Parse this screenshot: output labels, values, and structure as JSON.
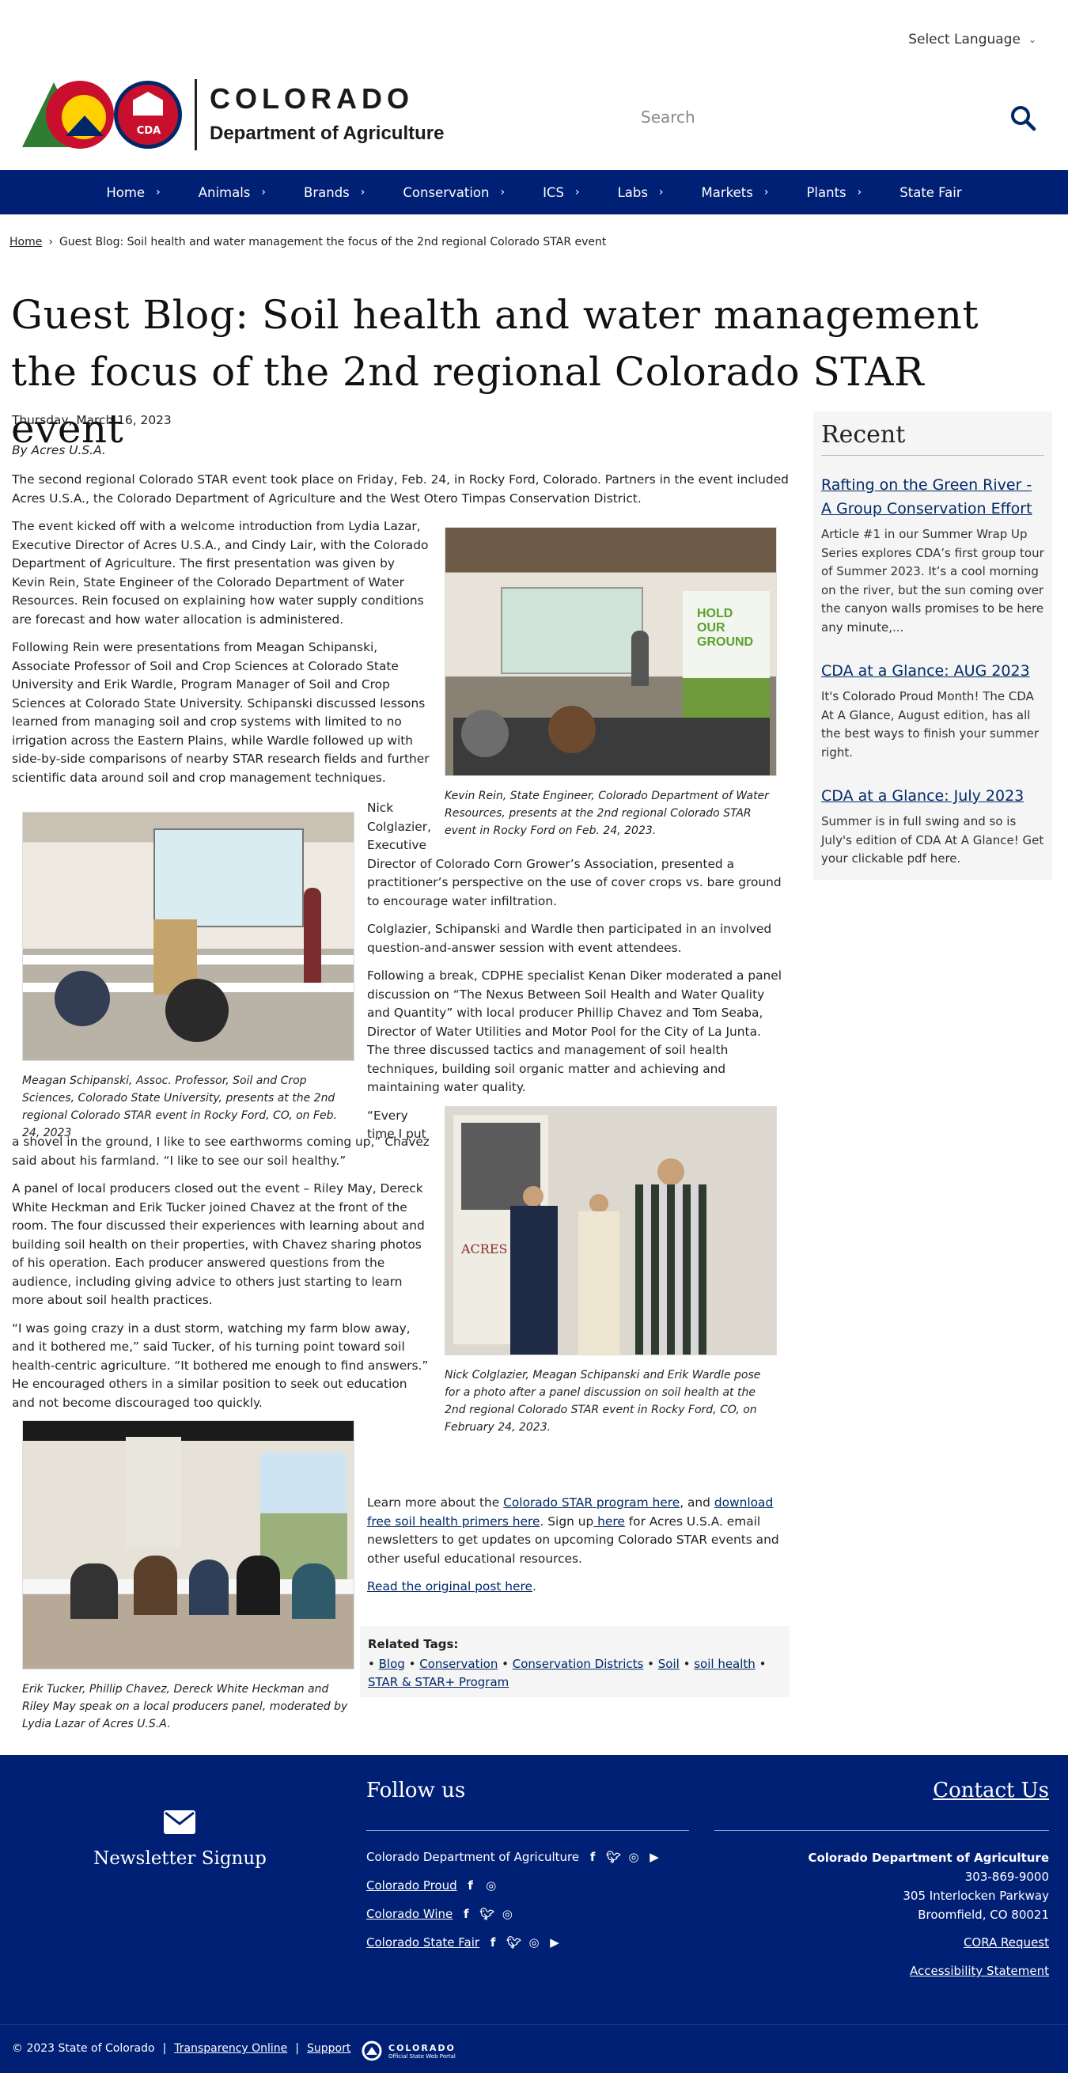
{
  "header": {
    "language_label": "Select Language",
    "logo_title": "COLORADO",
    "logo_subtitle": "Department of Agriculture",
    "logo_badge": "CDA",
    "search_placeholder": "Search"
  },
  "nav": {
    "items": [
      {
        "label": "Home"
      },
      {
        "label": "Animals"
      },
      {
        "label": "Brands"
      },
      {
        "label": "Conservation"
      },
      {
        "label": "ICS"
      },
      {
        "label": "Labs"
      },
      {
        "label": "Markets"
      },
      {
        "label": "Plants"
      },
      {
        "label": "State Fair"
      }
    ]
  },
  "breadcrumb": {
    "home": "Home",
    "current": "Guest Blog: Soil health and water management the focus of the 2nd regional Colorado STAR event"
  },
  "article": {
    "title": "Guest Blog: Soil health and water management the focus of the 2nd regional Colorado STAR event",
    "date": "Thursday, March 16, 2023",
    "byline": "By Acres U.S.A.",
    "p1": "The second regional Colorado STAR event took place on Friday, Feb. 24, in Rocky Ford, Colorado. Partners in the event included Acres U.S.A., the Colorado Department of Agriculture and the West Otero Timpas Conservation District.",
    "p2": "The event kicked off with a welcome introduction from Lydia Lazar, Executive Director of Acres U.S.A., and Cindy Lair, with the Colorado Department of Agriculture. The first presentation was given by Kevin Rein, State Engineer of the Colorado Department of Water Resources. Rein focused on explaining how water supply conditions are forecast and how water allocation is administered.",
    "p3": "Following Rein were presentations from Meagan Schipanski, Associate Professor of Soil and Crop Sciences at Colorado State University and Erik Wardle, Program Manager of Soil and Crop Sciences at Colorado State University. Schipanski discussed lessons learned from managing soil and crop systems with limited to no irrigation across the Eastern Plains, while Wardle followed up with side-by-side comparisons of nearby STAR research fields and further scientific data around soil and crop management techniques.",
    "p4a": "Nick",
    "p4b": "Colglazier,",
    "p4c": "Executive",
    "p4d": "Director of Colorado Corn Grower’s Association, presented a practitioner’s perspective on the use of cover crops vs. bare ground to encourage water infiltration.",
    "p5": "Colglazier, Schipanski and Wardle then participated in an involved question-and-answer session with event attendees.",
    "p6": "Following a break, CDPHE specialist Kenan Diker moderated a panel discussion on “The Nexus Between Soil Health and Water Quality and Quantity” with local producer Phillip Chavez and Tom Seaba, Director of Water Utilities and Motor Pool for the City of La Junta. The three discussed tactics and management of soil health techniques, building soil organic matter and achieving and maintaining water quality.",
    "p7a": "“Every",
    "p7b": "time I put",
    "p7c": "a shovel in the ground, I like to see earthworms coming up,” Chavez said about his farmland. “I like to see our soil healthy.”",
    "p8": "A panel of local producers closed out the event – Riley May, Dereck White Heckman and Erik Tucker joined Chavez at the front of the room. The four discussed their experiences with learning about and building soil health on their properties, with Chavez sharing photos of his operation. Each producer answered questions from the audience, including giving advice to others just starting to learn more about soil health practices.",
    "p9": "“I was going crazy in a dust storm, watching my farm blow away, and it bothered me,” said Tucker, of his turning point toward soil health-centric agriculture. “It bothered me enough to find answers.” He encouraged others in a similar position to seek out education and not become discouraged too quickly.",
    "p10_pre": "Learn more about the ",
    "p10_link1": "Colorado STAR program here",
    "p10_mid1": ", and ",
    "p10_link2": "download free soil health primers here",
    "p10_mid2": ". Sign up",
    "p10_link3": " here",
    "p10_post": " for Acres U.S.A. email newsletters to get updates on upcoming Colorado STAR events and other useful educational resources.",
    "p11_link": "Read the original post here",
    "p11_post": ".",
    "captions": {
      "c1": "Kevin Rein, State Engineer, Colorado Department of Water Resources, presents at the 2nd regional Colorado STAR event in Rocky Ford on Feb. 24, 2023.",
      "c2": "Meagan Schipanski, Assoc. Professor, Soil and Crop Sciences, Colorado State University, presents at the 2nd regional Colorado STAR event in Rocky Ford, CO, on Feb. 24, 2023",
      "c3": "Nick Colglazier, Meagan Schipanski and Erik Wardle pose for a photo after a panel discussion on soil health at the 2nd regional Colorado STAR event in Rocky Ford, CO, on February 24, 2023.",
      "c4": "Erik Tucker, Phillip Chavez, Dereck White Heckman and Riley May speak on a local producers panel, moderated by Lydia Lazar of Acres U.S.A."
    },
    "photo_text": {
      "banner_line1": "HOLD",
      "banner_line2": "OUR",
      "banner_line3": "GROUND",
      "acres": "ACRES"
    },
    "related_tags_title": "Related Tags:",
    "tags": [
      "Blog",
      "Conservation",
      "Conservation Districts",
      "Soil",
      "soil health",
      "STAR & STAR+ Program"
    ]
  },
  "sidebar": {
    "title": "Recent",
    "items": [
      {
        "title": "Rafting on the Green River - A Group Conservation Effort",
        "summary": "Article #1 in our Summer Wrap Up Series explores CDA’s first group tour of Summer 2023.   It’s a cool morning on the river, but the sun coming over the canyon walls promises to be here any minute,..."
      },
      {
        "title": "CDA at a Glance: AUG 2023",
        "summary": "It's Colorado Proud Month! The CDA At A Glance, August edition, has all the best ways to finish your summer right."
      },
      {
        "title": "CDA at a Glance: July 2023",
        "summary": "Summer is in full swing and so is July's edition of CDA At A Glance! Get your clickable pdf here."
      }
    ]
  },
  "footer": {
    "newsletter": "Newsletter Signup",
    "follow_title": "Follow us",
    "contact_title": "Contact Us",
    "social": [
      {
        "label": "Colorado Department of Agriculture",
        "icons": [
          "facebook-icon",
          "twitter-icon",
          "instagram-icon",
          "youtube-icon"
        ]
      },
      {
        "label": "Colorado Proud",
        "icons": [
          "facebook-icon",
          "instagram-icon"
        ]
      },
      {
        "label": "Colorado Wine",
        "icons": [
          "facebook-icon",
          "twitter-icon",
          "instagram-icon"
        ]
      },
      {
        "label": "Colorado State Fair",
        "icons": [
          "facebook-icon",
          "twitter-icon",
          "instagram-icon",
          "youtube-icon"
        ]
      }
    ],
    "address": {
      "org": "Colorado Department of Agriculture",
      "phone": "303-869-9000",
      "street": "305 Interlocken Parkway",
      "city": "Broomfield, CO 80021"
    },
    "cora": "CORA Request",
    "accessibility": "Accessibility Statement",
    "copyright": "© 2023 State of Colorado",
    "sep": "|",
    "transparency": "Transparency Online",
    "support": "Support",
    "portal_title": "COLORADO",
    "portal_sub": "Official State Web Portal"
  },
  "colors": {
    "nav_bg": "#002075",
    "link": "#002868",
    "sidebar_bg": "#f5f5f5"
  }
}
